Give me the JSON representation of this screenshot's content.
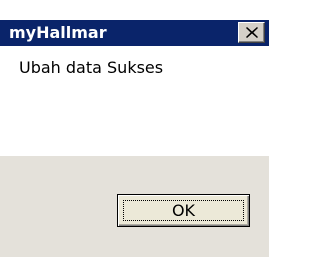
{
  "window": {
    "title": "myHallmar",
    "close_icon": "close-icon"
  },
  "message": {
    "text": "Ubah data Sukses"
  },
  "buttons": {
    "ok_label": "OK"
  },
  "colors": {
    "titlebar": "#0a246a",
    "title_text": "#ffffff",
    "button_area": "#e4e1da"
  }
}
